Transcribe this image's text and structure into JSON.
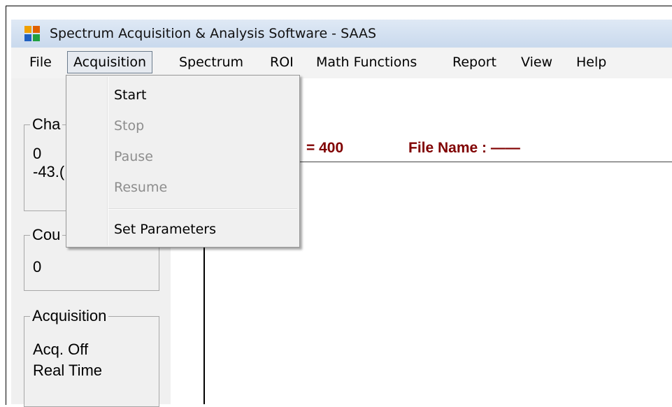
{
  "window": {
    "title": "Spectrum Acquisition & Analysis Software - SAAS",
    "icon": "hfc-app-icon"
  },
  "menubar": {
    "items": [
      "File",
      "Acquisition",
      "Spectrum",
      "ROI",
      "Math Functions",
      "Report",
      "View",
      "Help"
    ],
    "open_item": "Acquisition"
  },
  "acquisition_menu": {
    "items": [
      {
        "label": "Start",
        "enabled": true
      },
      {
        "label": "Stop",
        "enabled": false
      },
      {
        "label": "Pause",
        "enabled": false
      },
      {
        "label": "Resume",
        "enabled": false
      },
      {
        "label": "Set Parameters",
        "enabled": true
      }
    ]
  },
  "side_panel": {
    "channel_group": {
      "title": "Cha",
      "line1": "0",
      "line2": "-43.("
    },
    "counts_group": {
      "title": "Cou",
      "value": "0"
    },
    "acquisition_group": {
      "title": "Acquisition",
      "status": "Acq. Off",
      "mode": "Real Time"
    }
  },
  "plot_header": {
    "channels_text": "= 400",
    "file_name_text": "File Name : ——"
  },
  "colors": {
    "info_text": "#800000",
    "menu_disabled": "#8d8d8d",
    "titlebar": "#c9d9ed"
  }
}
